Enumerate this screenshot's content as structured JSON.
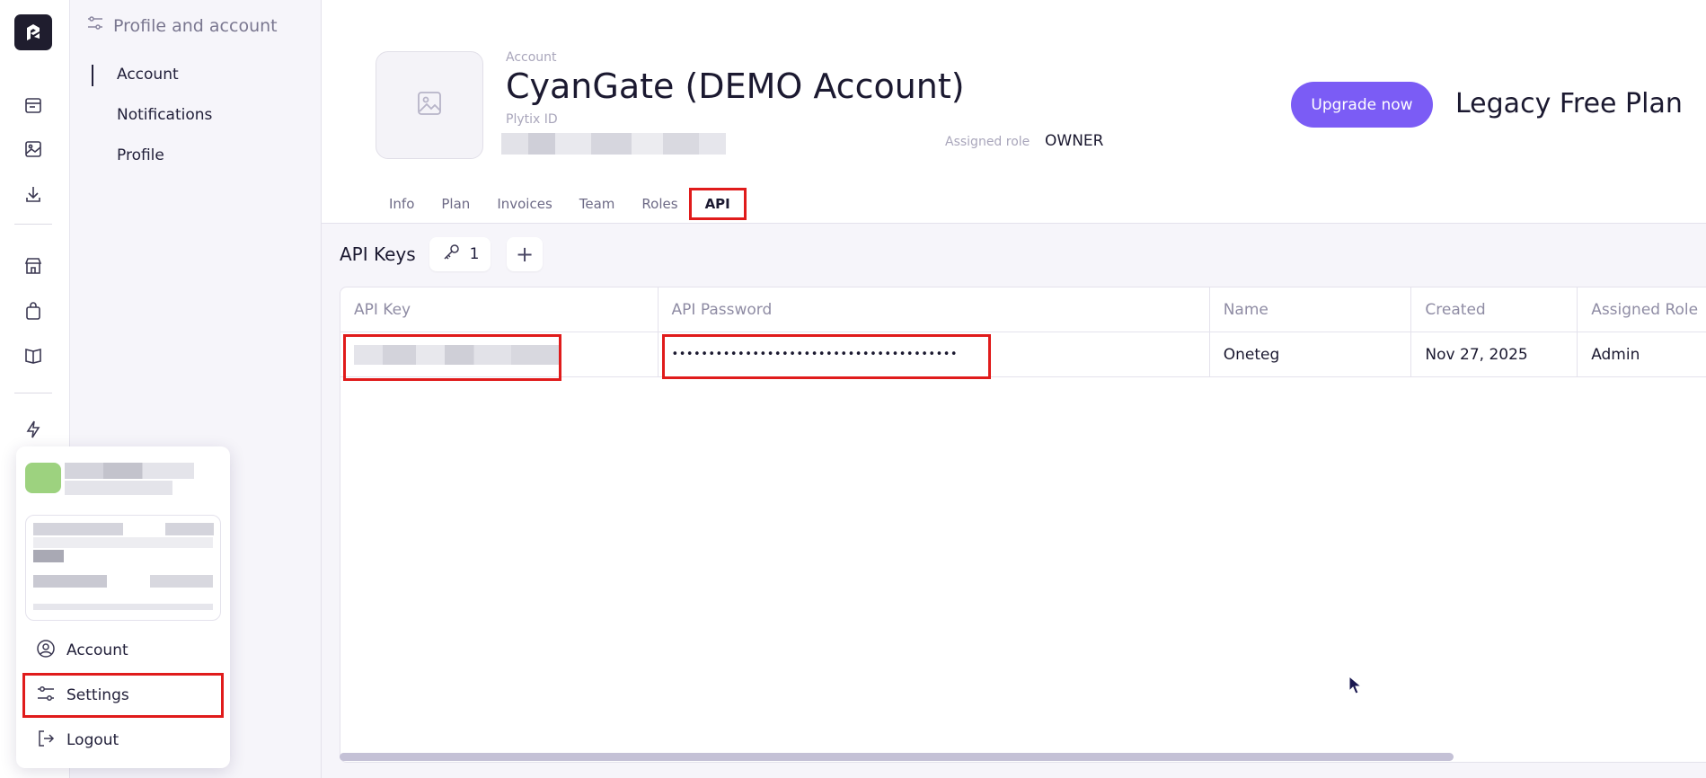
{
  "rail": {
    "icons": [
      "logo-icon",
      "calendar-icon",
      "image-icon",
      "download-icon",
      "store-icon",
      "bag-icon",
      "book-icon",
      "lightning-icon"
    ]
  },
  "sidebar": {
    "title": "Profile and account",
    "items": [
      {
        "label": "Account",
        "active": true
      },
      {
        "label": "Notifications",
        "active": false
      },
      {
        "label": "Profile",
        "active": false
      }
    ]
  },
  "popup": {
    "items": [
      {
        "label": "Account",
        "icon": "user-circle-icon"
      },
      {
        "label": "Settings",
        "icon": "sliders-icon"
      },
      {
        "label": "Logout",
        "icon": "logout-icon"
      }
    ]
  },
  "account": {
    "label": "Account",
    "name": "CyanGate (DEMO Account)",
    "id_label": "Plytix ID",
    "role_label": "Assigned role",
    "role_value": "OWNER",
    "upgrade_label": "Upgrade now",
    "plan_name": "Legacy Free Plan"
  },
  "tabs": [
    {
      "label": "Info",
      "active": false
    },
    {
      "label": "Plan",
      "active": false
    },
    {
      "label": "Invoices",
      "active": false
    },
    {
      "label": "Team",
      "active": false
    },
    {
      "label": "Roles",
      "active": false
    },
    {
      "label": "API",
      "active": true
    }
  ],
  "api": {
    "title": "API Keys",
    "count": "1",
    "add_label": "+",
    "columns": [
      "API Key",
      "API Password",
      "Name",
      "Created",
      "Assigned Role"
    ],
    "rows": [
      {
        "key": "",
        "password": "•••••••••••••••••••••••••••••••••••••••",
        "name": "Oneteg",
        "created": "Nov 27, 2025",
        "role": "Admin"
      }
    ]
  },
  "colors": {
    "accent": "#7b5cf5",
    "highlight": "#e01b1b"
  }
}
